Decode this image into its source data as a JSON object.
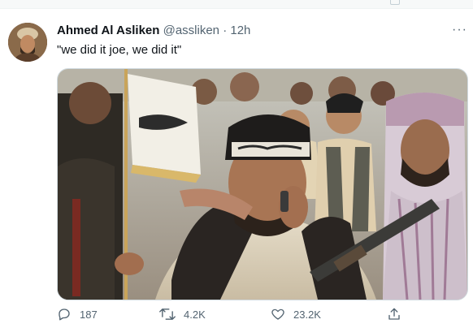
{
  "tweet": {
    "author_name": "Ahmed Al Asliken",
    "handle": "@assliken",
    "separator": "·",
    "time": "12h",
    "more_label": "···",
    "text": "\"we did it joe, we did it\""
  },
  "actions": {
    "reply_count": "187",
    "retweet_count": "4.2K",
    "like_count": "23.2K"
  },
  "icons": {
    "reply": "reply-icon",
    "retweet": "retweet-icon",
    "like": "heart-icon",
    "share": "share-icon",
    "more": "more-icon"
  },
  "colors": {
    "text": "#0f1419",
    "muted": "#536471",
    "border": "#cfd9de"
  }
}
